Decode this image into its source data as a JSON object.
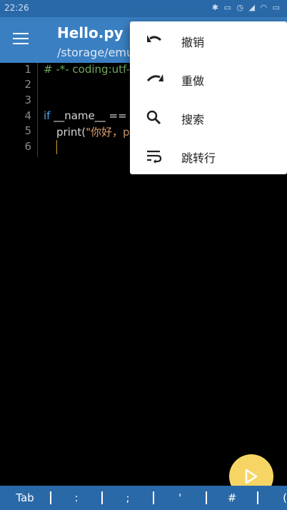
{
  "status_bar": {
    "time": "22:26",
    "icons": [
      "bluetooth-icon",
      "vibrate-icon",
      "alarm-icon",
      "signal-icon",
      "wifi-icon",
      "battery-icon"
    ]
  },
  "app_bar": {
    "title": "Hello.py",
    "subtitle": "/storage/emu"
  },
  "editor": {
    "line_numbers": [
      "1",
      "2",
      "3",
      "4",
      "5",
      "6"
    ],
    "lines": {
      "l1": "# -*- coding:utf-",
      "l4_kw": "if",
      "l4_rest": " __name__ ==",
      "l5_a": "print(",
      "l5_b": "\"你好，p"
    }
  },
  "menu": {
    "items": [
      {
        "label": "撤销",
        "icon": "undo-icon"
      },
      {
        "label": "重做",
        "icon": "redo-icon"
      },
      {
        "label": "搜索",
        "icon": "search-icon"
      },
      {
        "label": "跳转行",
        "icon": "wrap-text-icon"
      }
    ]
  },
  "fab": {
    "icon": "play-icon"
  },
  "key_bar": {
    "keys": [
      "Tab",
      ":",
      ";",
      "'",
      "#",
      "("
    ]
  },
  "colors": {
    "primary": "#3a7fc2",
    "status": "#2a69a8",
    "fab": "#f6d565",
    "comment": "#6fa85a",
    "keyword": "#4ea3ea"
  }
}
